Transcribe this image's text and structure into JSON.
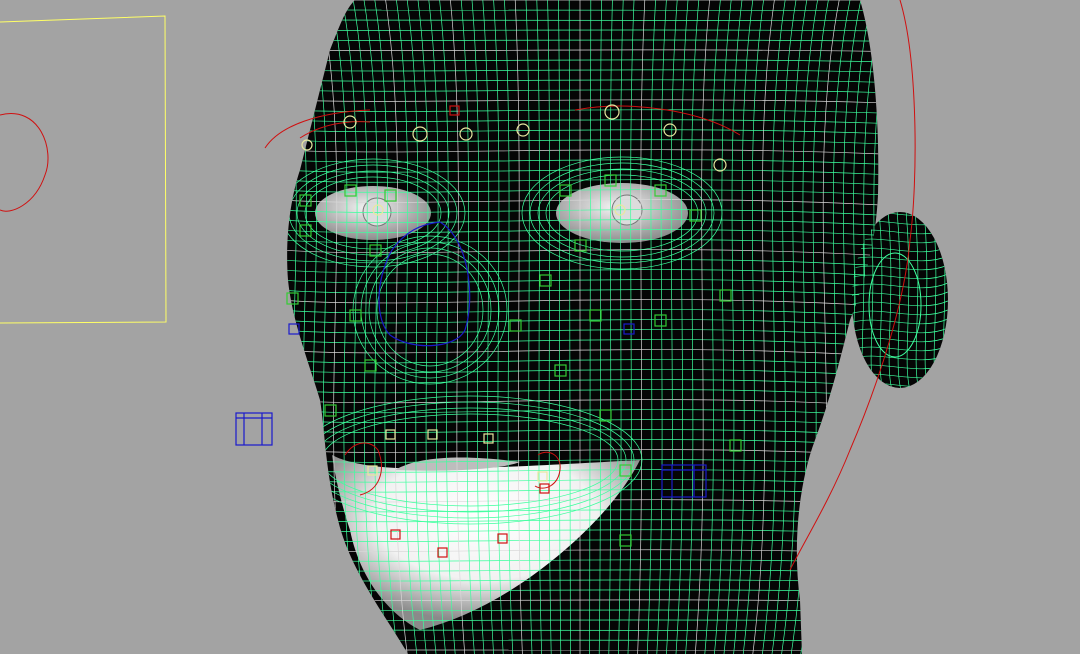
{
  "viewport": {
    "background": "#a3a3a3",
    "object": "head-mesh",
    "display_mode": "wireframe-on-shaded"
  },
  "colors": {
    "mesh_fill": "#050505",
    "wire_primary": "#3dff9e",
    "wire_secondary": "#d8d8d8",
    "control_green": "#33cc33",
    "control_yellow": "#e8e8a0",
    "control_red": "#d01010",
    "control_blue": "#1a1acc",
    "frame_yellow": "#ffff66",
    "eyeball": "#c8c8c8"
  },
  "icons": {
    "camera_frame": "camera-frame-icon",
    "locator": "locator-icon"
  }
}
